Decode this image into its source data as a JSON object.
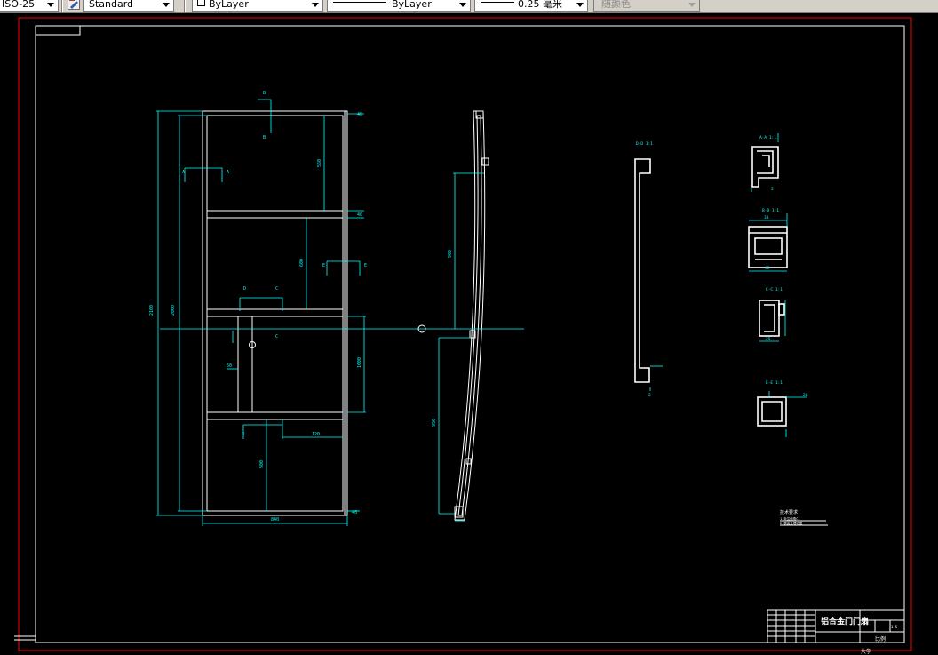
{
  "toolbar": {
    "dimstyle_value": "ISO-25",
    "textstyle_value": "Standard",
    "layer_value": "ByLayer",
    "linetype_value": "ByLayer",
    "lineweight_value": "0.25 毫米",
    "plotstyle_value": "随颜色"
  },
  "drawing": {
    "section_labels": {
      "a": "A",
      "b": "B",
      "c": "C",
      "d": "D",
      "e": "E"
    },
    "detail_titles": {
      "a": "A-A 1:1",
      "b": "B-B 1:1",
      "c": "C-C 1:1",
      "d": "D-D 1:1",
      "e": "E-E 1:1"
    },
    "dims": {
      "overall_height": "2100",
      "inner_height": "2060",
      "overall_width": "840",
      "panel_top": "560",
      "panel_mid": "600",
      "panel_bottom": "500",
      "rail": "40",
      "stile": "40",
      "lock_height": "1000",
      "upper_height": "900",
      "lower_height": "950",
      "handle_x": "120",
      "handle_y": "50",
      "profile_a": "30",
      "profile_b": "45",
      "profile_c": "25",
      "profile_d": "20",
      "profile_e": "2"
    },
    "tech_notes": {
      "heading": "技术要求",
      "line1": "1.未注倒角C1",
      "line2": "2.表面处理喷塑"
    },
    "title_block": {
      "drawing_name": "铝合金门门扇",
      "school": "大学",
      "drawing_no": "比例",
      "scale": "1:5"
    }
  }
}
